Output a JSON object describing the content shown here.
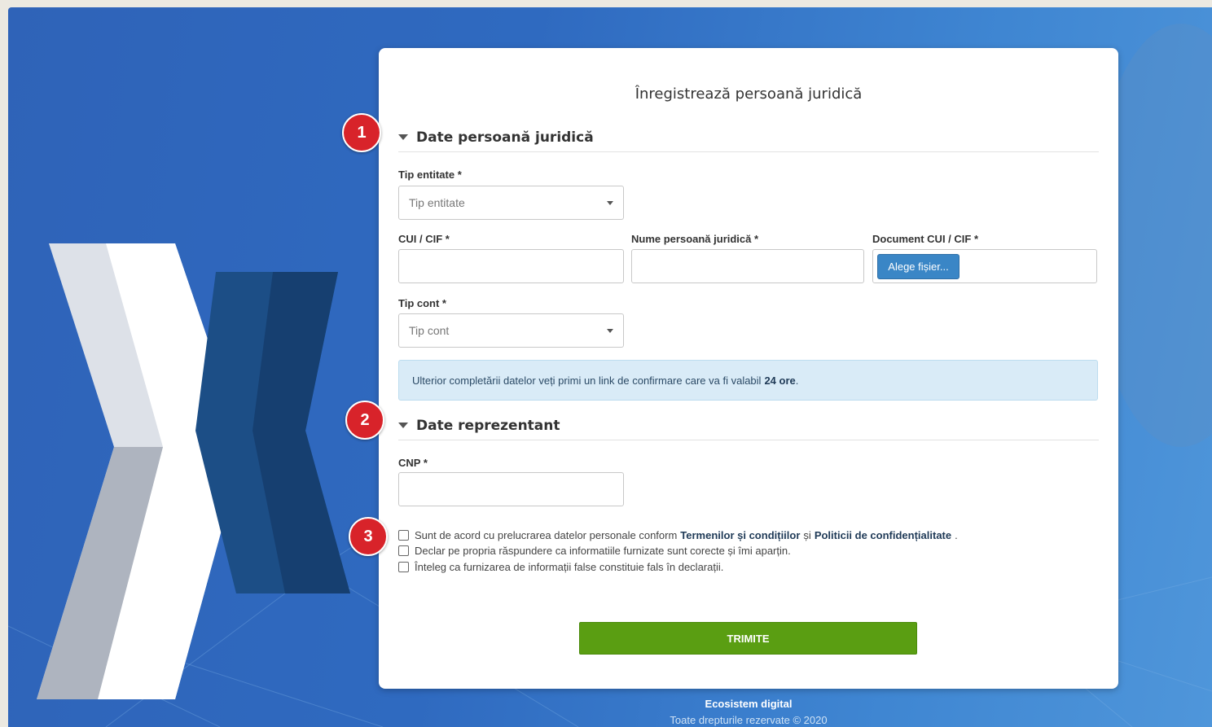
{
  "page": {
    "title": "Înregistrează persoană juridică"
  },
  "sections": {
    "company": {
      "label": "Date persoană juridică",
      "marker": "1"
    },
    "representative": {
      "label": "Date reprezentant",
      "marker": "2"
    },
    "consent_marker": "3"
  },
  "fields": {
    "tip_entitate": {
      "label": "Tip entitate *",
      "placeholder": "Tip entitate"
    },
    "cui": {
      "label": "CUI / CIF *",
      "value": ""
    },
    "nume": {
      "label": "Nume persoană juridică *",
      "value": ""
    },
    "document": {
      "label": "Document CUI / CIF *",
      "button": "Alege fișier..."
    },
    "tip_cont": {
      "label": "Tip cont *",
      "placeholder": "Tip cont"
    },
    "cnp": {
      "label": "CNP *",
      "value": ""
    }
  },
  "info": {
    "text": "Ulterior completării datelor veți primi un link de confirmare care va fi valabil",
    "highlight": "24 ore",
    "suffix": "."
  },
  "consents": [
    {
      "text_before": "Sunt de acord cu prelucrarea datelor personale conform",
      "link1": "Termenilor și condițiilor",
      "middle": "și",
      "link2": "Politicii de confidențialitate",
      "text_after": ".",
      "checked": false
    },
    {
      "text": "Declar pe propria răspundere ca informatiile furnizate sunt corecte și îmi aparțin.",
      "checked": false
    },
    {
      "text": "Înteleg ca furnizarea de informații false constituie fals în declarații.",
      "checked": false
    }
  ],
  "submit": {
    "label": "TRIMITE",
    "color": "#5a9e12"
  },
  "footer": {
    "brand": "Ecosistem digital",
    "copyright": "Toate drepturile rezervate © 2020"
  },
  "colors": {
    "background": "#2f63b8",
    "marker": "#d8232a",
    "info_bg": "#d9ebf7",
    "file_button": "#3a86c6"
  }
}
